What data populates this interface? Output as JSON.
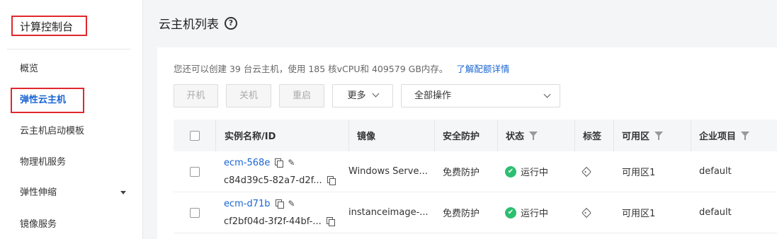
{
  "sidebar": {
    "title": "计算控制台",
    "items": [
      {
        "label": "概览"
      },
      {
        "label": "弹性云主机"
      },
      {
        "label": "云主机启动模板"
      },
      {
        "label": "物理机服务"
      },
      {
        "label": "弹性伸缩"
      },
      {
        "label": "镜像服务"
      }
    ]
  },
  "header": {
    "title": "云主机列表",
    "help_glyph": "?"
  },
  "quota": {
    "text": "您还可以创建 39 台云主机，使用 185 核vCPU和 409579 GB内存。",
    "link": "了解配额详情"
  },
  "toolbar": {
    "start_label": "开机",
    "stop_label": "关机",
    "restart_label": "重启",
    "more_label": "更多",
    "ops_select_value": "全部操作"
  },
  "table": {
    "columns": [
      "实例名称/ID",
      "镜像",
      "安全防护",
      "状态",
      "标签",
      "可用区",
      "企业项目"
    ],
    "rows": [
      {
        "name": "ecm-568e",
        "id": "c84d39c5-82a7-d2f...",
        "image": "Windows Serve...",
        "security": "免费防护",
        "status": "运行中",
        "zone": "可用区1",
        "project": "default"
      },
      {
        "name": "ecm-d71b",
        "id": "cf2bf04d-3f2f-44bf-...",
        "image": "instanceimage-...",
        "security": "免费防护",
        "status": "运行中",
        "zone": "可用区1",
        "project": "default"
      }
    ]
  },
  "colors": {
    "accent": "#1a66d4",
    "highlight_border": "#e0282e",
    "status_ok": "#2cbf72"
  }
}
